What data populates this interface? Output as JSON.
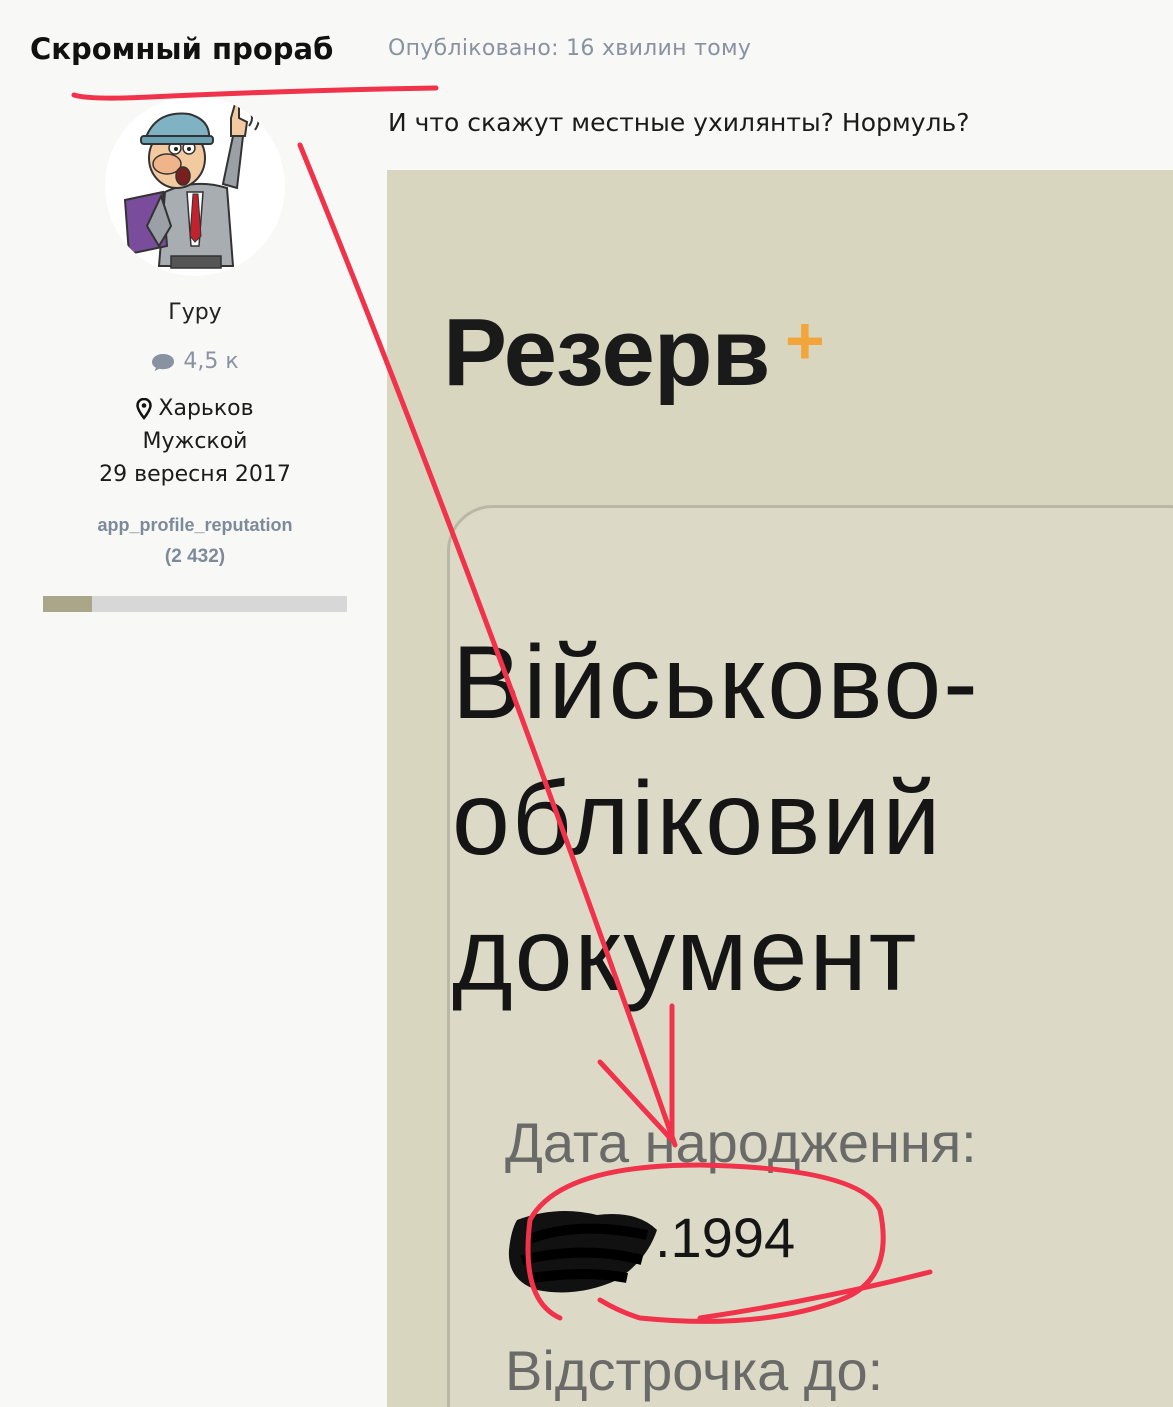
{
  "author": {
    "name": "Скромный прораб",
    "rank": "Гуру",
    "posts_count": "4,5 к",
    "location": "Харьков",
    "gender": "Мужской",
    "joined": "29 вересня 2017",
    "reputation_label": "app_profile_reputation",
    "reputation_count": "(2 432)",
    "reputation_level": 0.16
  },
  "post": {
    "meta": "Опубліковано: 16 хвилин тому",
    "text": "И что скажут местные ухилянты? Нормуль?"
  },
  "attachment": {
    "brand": "Резерв",
    "brand_plus": "+",
    "title_line1": "Військово-",
    "title_line2": "обліковий",
    "title_line3": "документ",
    "dob_label": "Дата народження:",
    "dob_value": ".1994",
    "deferral_label": "Відстрочка до:"
  },
  "icons": {
    "posts": "comment-icon",
    "location": "map-marker-icon"
  },
  "colors": {
    "annotation": "#f0324a",
    "muted_text": "#8892a0",
    "brand_plus": "#f2a53a",
    "reputation_fill": "#a9a689"
  }
}
